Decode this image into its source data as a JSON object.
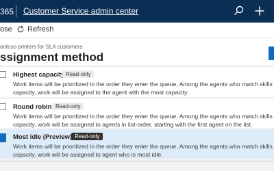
{
  "topbar": {
    "brand": "365",
    "title": "Customer Service admin center"
  },
  "commands": {
    "close": "ose",
    "refresh": "Refresh"
  },
  "header": {
    "breadcrumb": "ontoso printers for SLA customers",
    "title": "ssignment method"
  },
  "options": [
    {
      "name": "Highest capacity",
      "badge": "Read-only",
      "desc_line1": "Work items will be prioritized in the order they enter the queue. Among the agents who match skills",
      "desc_line2": "capacity, work will be assigned to the agent with the most capacity."
    },
    {
      "name": "Round robin",
      "badge": "Read-only",
      "desc_line1": "Work items will be prioritized in the order they enter the queue. Among the agents who match skills",
      "desc_line2": "capacity, work will be assigned to agents in list-order, starting with the first agent on the list."
    },
    {
      "name": "Most idle (Preview)",
      "badge": "Read-only",
      "desc_line1": "Work items will be prioritized in the order they enter the queue. Among the agents who match skills",
      "desc_line2": "capacity, work will be assigned to agent who is most idle."
    }
  ],
  "colors": {
    "topbar": "#0b2e55",
    "accent": "#0f6cbd",
    "selected_row": "#deecf9"
  }
}
